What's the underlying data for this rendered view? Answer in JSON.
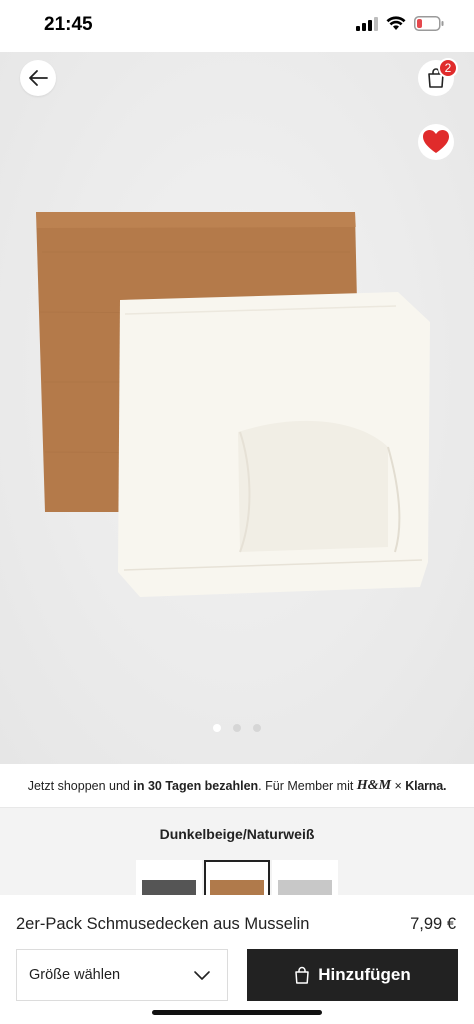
{
  "status": {
    "time": "21:45",
    "battery_color": "#e5484d"
  },
  "header": {
    "back_icon": "arrow-left-icon",
    "bag_icon": "shopping-bag-icon",
    "bag_count": "2",
    "favorite_icon": "heart-icon",
    "favorite_color": "#e02b2b"
  },
  "gallery": {
    "image_count": 3,
    "active_index": 0
  },
  "promo": {
    "prefix": "Jetzt shoppen und ",
    "bold": "in 30 Tagen bezahlen",
    "suffix": ". Für Member mit ",
    "brand": "H&M",
    "separator": " × ",
    "partner": "Klarna."
  },
  "product": {
    "color_name": "Dunkelbeige/Naturweiß",
    "swatches": [
      {
        "color": "#555555",
        "selected": false
      },
      {
        "color": "#b07a4b",
        "selected": true
      },
      {
        "color": "#c8c8c8",
        "selected": false
      }
    ],
    "name": "2er-Pack Schmusedecken aus Musselin",
    "price": "7,99 €"
  },
  "actions": {
    "size_placeholder": "Größe wählen",
    "add_label": "Hinzufügen"
  }
}
